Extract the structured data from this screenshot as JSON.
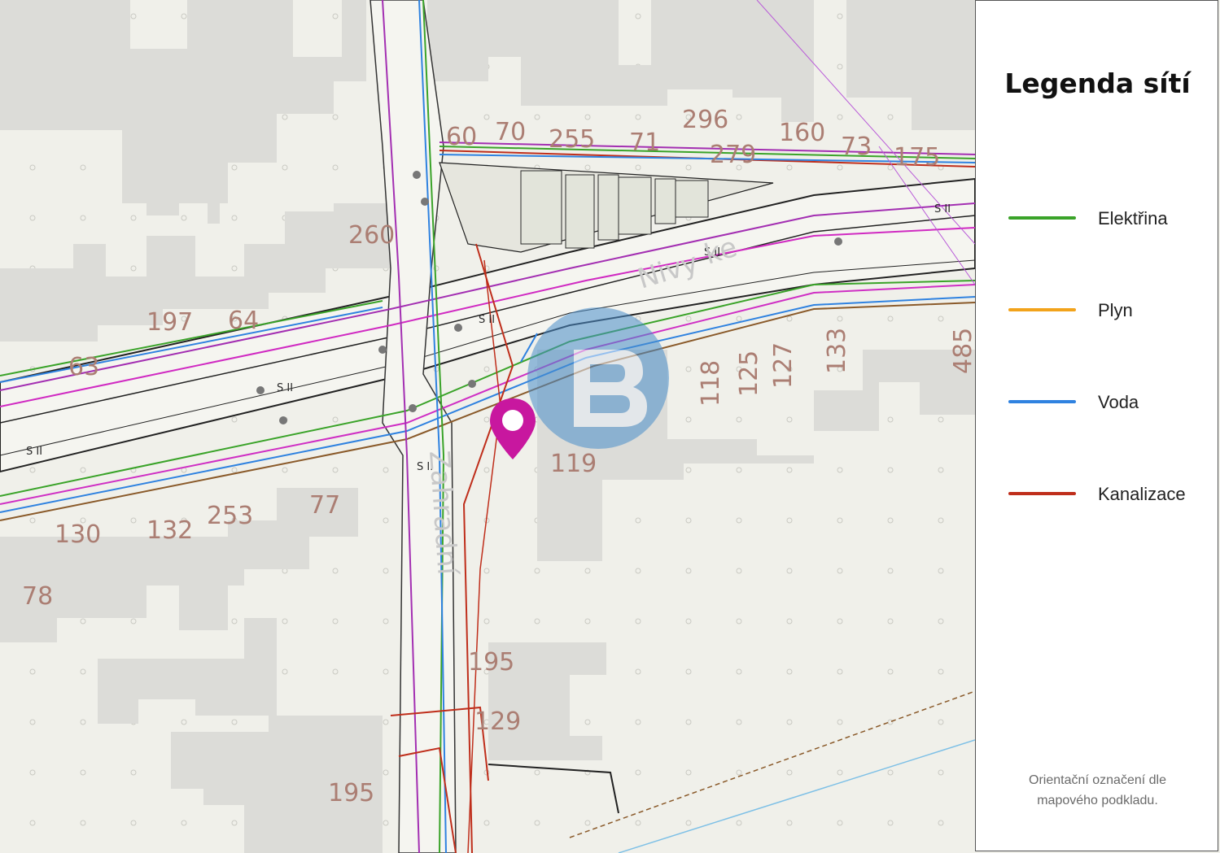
{
  "legend": {
    "title": "Legenda sítí",
    "items": [
      {
        "label": "Elektřina",
        "color": "#3aa329"
      },
      {
        "label": "Plyn",
        "color": "#f2a31b"
      },
      {
        "label": "Voda",
        "color": "#2f82e0"
      },
      {
        "label": "Kanalizace",
        "color": "#bf2e1b"
      }
    ],
    "note_line1": "Orientační označení dle",
    "note_line2": "mapového podkladu."
  },
  "map": {
    "parcel_numbers": [
      "296",
      "160",
      "73",
      "60",
      "70",
      "255",
      "71",
      "279",
      "175",
      "260",
      "197",
      "64",
      "63",
      "118",
      "125",
      "127",
      "133",
      "485",
      "119",
      "130",
      "132",
      "253",
      "77",
      "78",
      "195",
      "129",
      "195"
    ],
    "road_labels": [
      "S II",
      "S II",
      "S II",
      "S II",
      "S II",
      "S II"
    ],
    "street_names": [
      "Nivy",
      "ke",
      "Zahradní"
    ],
    "marker_color": "#c8179f",
    "watermark_color": "#4a8ecb"
  }
}
